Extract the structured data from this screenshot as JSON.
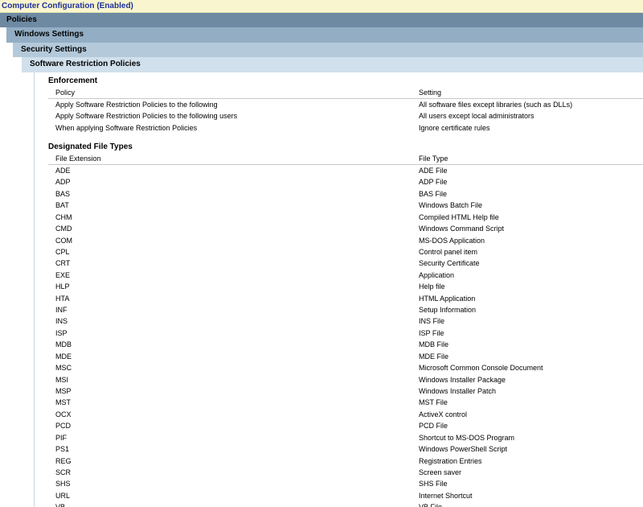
{
  "headers": {
    "computer_config": "Computer Configuration (Enabled)",
    "policies": "Policies",
    "windows_settings": "Windows Settings",
    "security_settings": "Security Settings",
    "srp": "Software Restriction Policies"
  },
  "enforcement": {
    "title": "Enforcement",
    "col_policy": "Policy",
    "col_setting": "Setting",
    "rows": [
      {
        "policy": "Apply Software Restriction Policies to the following",
        "setting": "All software files except libraries (such as DLLs)"
      },
      {
        "policy": "Apply Software Restriction Policies to the following users",
        "setting": "All users except local administrators"
      },
      {
        "policy": "When applying Software Restriction Policies",
        "setting": "Ignore certificate rules"
      }
    ]
  },
  "file_types": {
    "title": "Designated File Types",
    "col_ext": "File Extension",
    "col_type": "File Type",
    "rows": [
      {
        "ext": "ADE",
        "type": "ADE File"
      },
      {
        "ext": "ADP",
        "type": "ADP File"
      },
      {
        "ext": "BAS",
        "type": "BAS File"
      },
      {
        "ext": "BAT",
        "type": "Windows Batch File"
      },
      {
        "ext": "CHM",
        "type": "Compiled HTML Help file"
      },
      {
        "ext": "CMD",
        "type": "Windows Command Script"
      },
      {
        "ext": "COM",
        "type": "MS-DOS Application"
      },
      {
        "ext": "CPL",
        "type": "Control panel item"
      },
      {
        "ext": "CRT",
        "type": "Security Certificate"
      },
      {
        "ext": "EXE",
        "type": "Application"
      },
      {
        "ext": "HLP",
        "type": "Help file"
      },
      {
        "ext": "HTA",
        "type": "HTML Application"
      },
      {
        "ext": "INF",
        "type": "Setup Information"
      },
      {
        "ext": "INS",
        "type": "INS File"
      },
      {
        "ext": "ISP",
        "type": "ISP File"
      },
      {
        "ext": "MDB",
        "type": "MDB File"
      },
      {
        "ext": "MDE",
        "type": "MDE File"
      },
      {
        "ext": "MSC",
        "type": "Microsoft Common Console Document"
      },
      {
        "ext": "MSI",
        "type": "Windows Installer Package"
      },
      {
        "ext": "MSP",
        "type": "Windows Installer Patch"
      },
      {
        "ext": "MST",
        "type": "MST File"
      },
      {
        "ext": "OCX",
        "type": "ActiveX control"
      },
      {
        "ext": "PCD",
        "type": "PCD File"
      },
      {
        "ext": "PIF",
        "type": "Shortcut to MS-DOS Program"
      },
      {
        "ext": "PS1",
        "type": "Windows PowerShell Script"
      },
      {
        "ext": "REG",
        "type": "Registration Entries"
      },
      {
        "ext": "SCR",
        "type": "Screen saver"
      },
      {
        "ext": "SHS",
        "type": "SHS File"
      },
      {
        "ext": "URL",
        "type": "Internet Shortcut"
      },
      {
        "ext": "VB",
        "type": "VB File"
      }
    ]
  }
}
